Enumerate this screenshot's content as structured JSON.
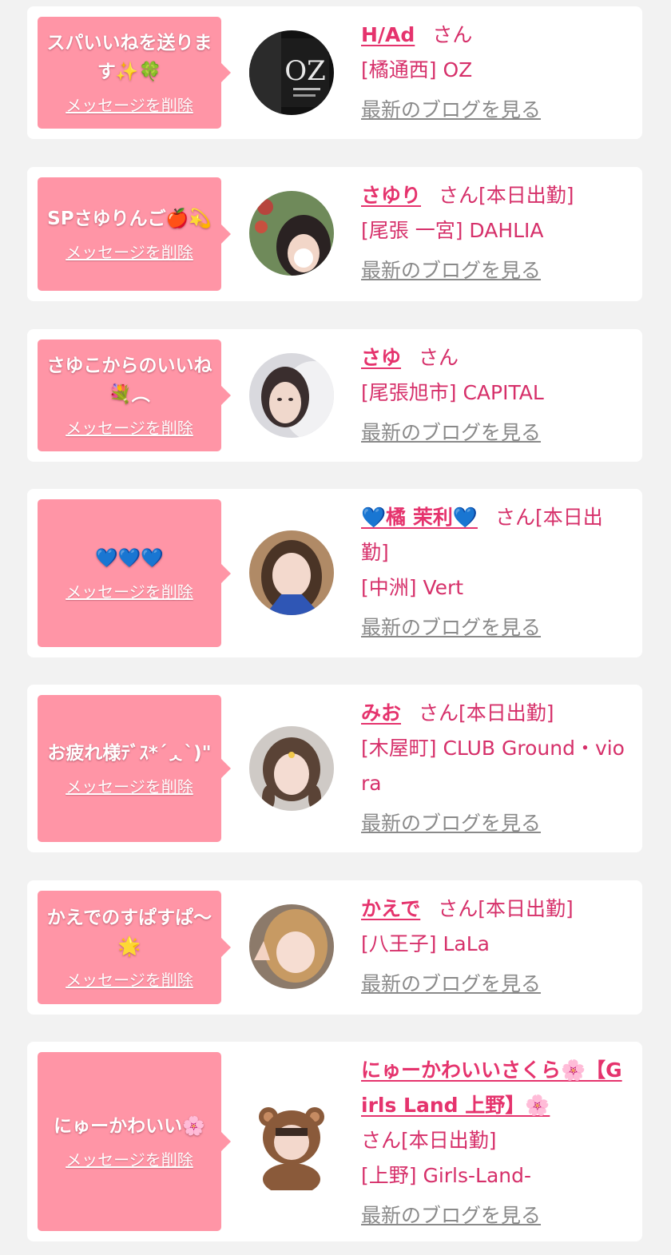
{
  "colors": {
    "page_bg": "#f2f2f2",
    "card_bg": "#ffffff",
    "bubble_bg": "#ff95a6",
    "name_color": "#e5336d",
    "text_pink": "#d6306a",
    "blog_link_gray": "#8a8a8a"
  },
  "items": [
    {
      "message": "スパいいねを送ります✨🍀",
      "delete_label": "メッセージを削除",
      "name": "H/Ad",
      "honorific": "さん",
      "status": "",
      "shop": "[橘通西] OZ",
      "blog_label": "最新のブログを見る",
      "avatar_icon": "oz-logo-avatar"
    },
    {
      "message": "SPさゆりんご🍎💫",
      "delete_label": "メッセージを削除",
      "name": "さゆり",
      "honorific": "さん",
      "status": "[本日出勤]",
      "shop": "[尾張 一宮] DAHLIA",
      "blog_label": "最新のブログを見る",
      "avatar_icon": "girl-photo-avatar"
    },
    {
      "message": "さゆこからのいいね💐︵",
      "delete_label": "メッセージを削除",
      "name": "さゆ",
      "honorific": "さん",
      "status": "",
      "shop": "[尾張旭市] CAPITAL",
      "blog_label": "最新のブログを見る",
      "avatar_icon": "girl-photo-avatar"
    },
    {
      "message": "💙💙💙",
      "delete_label": "メッセージを削除",
      "name": "💙橘 茉利💙",
      "honorific": "さん",
      "status": "[本日出勤]",
      "shop": "[中洲] Vert",
      "blog_label": "最新のブログを見る",
      "avatar_icon": "girl-photo-avatar"
    },
    {
      "message": "お疲れ様ﾃﾞｽ*´ᆺ`)\"",
      "delete_label": "メッセージを削除",
      "name": "みお",
      "honorific": "さん",
      "status": "[本日出勤]",
      "shop": "[木屋町] CLUB Ground・viora",
      "blog_label": "最新のブログを見る",
      "avatar_icon": "girl-photo-avatar"
    },
    {
      "message": "かえでのすぱすぱ〜🌟",
      "delete_label": "メッセージを削除",
      "name": "かえで",
      "honorific": "さん",
      "status": "[本日出勤]",
      "shop": "[八王子] LaLa",
      "blog_label": "最新のブログを見る",
      "avatar_icon": "girl-photo-avatar"
    },
    {
      "message": "にゅーかわいい🌸",
      "delete_label": "メッセージを削除",
      "name": "にゅーかわいいさくら🌸【Girls Land 上野】🌸",
      "honorific": "さん",
      "status": "[本日出勤]",
      "shop": "[上野] Girls-Land-",
      "blog_label": "最新のブログを見る",
      "avatar_icon": "bear-costume-avatar"
    }
  ]
}
